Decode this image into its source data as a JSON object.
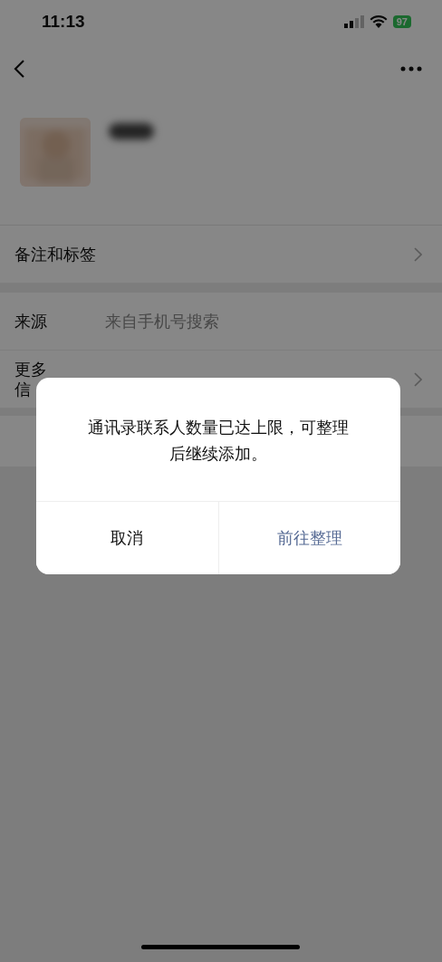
{
  "status_bar": {
    "time": "11:13",
    "battery": "97"
  },
  "rows": [
    {
      "label": "备注和标签",
      "chevron": true
    },
    {
      "label": "来源",
      "value": "来自手机号搜索",
      "chevron": false
    },
    {
      "label": "更多信",
      "chevron": true
    }
  ],
  "dialog": {
    "message": "通讯录联系人数量已达上限，可整理后继续添加。",
    "buttons": [
      {
        "label": "取消",
        "kind": "cancel"
      },
      {
        "label": "前往整理",
        "kind": "primary"
      }
    ]
  }
}
